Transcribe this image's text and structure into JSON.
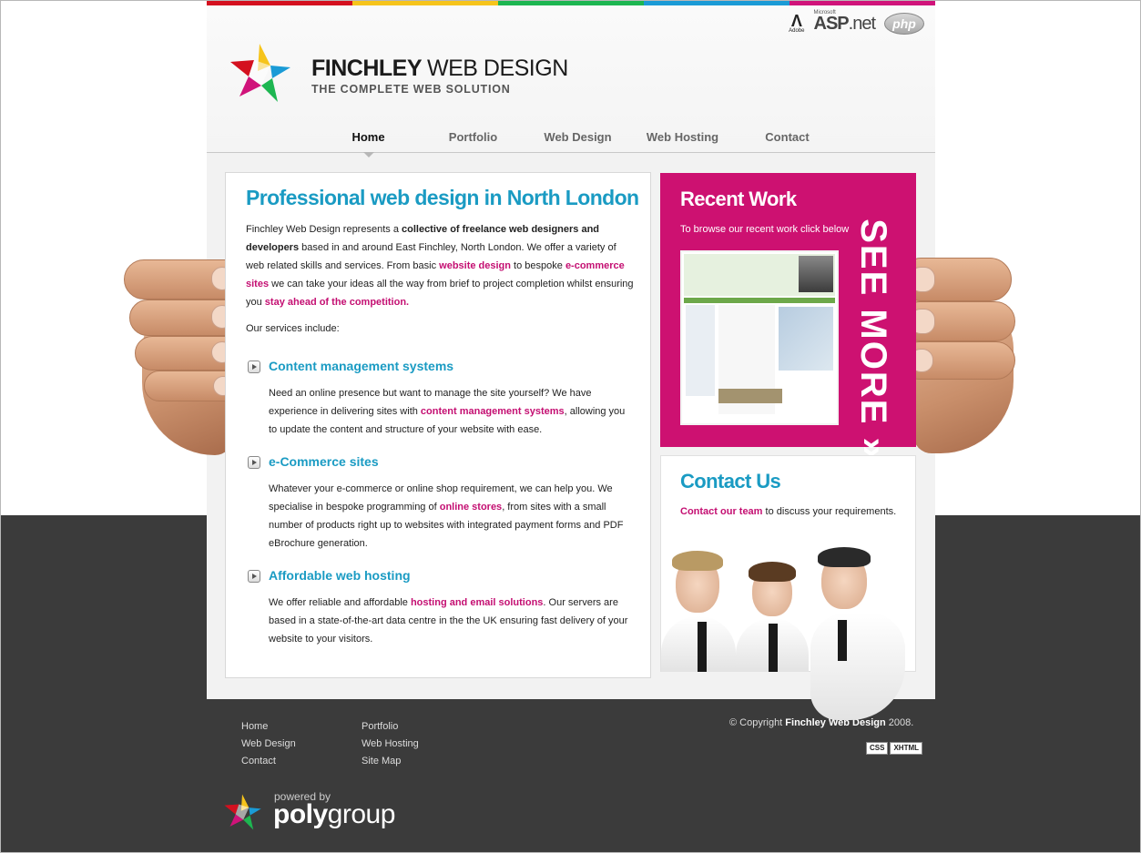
{
  "colors": {
    "accent_blue": "#1a9bc3",
    "accent_pink": "#cd1171",
    "bar": [
      "#d4101f",
      "#f6c41b",
      "#1db651",
      "#1a9bd6",
      "#d0137a"
    ]
  },
  "header": {
    "logo_title_bold": "FINCHLEY",
    "logo_title_rest": "WEB DESIGN",
    "logo_subtitle": "THE COMPLETE WEB SOLUTION",
    "tech_adobe": "Adobe",
    "tech_ms": "Microsoft",
    "tech_asp": "ASP",
    "tech_net": ".net",
    "tech_php": "php"
  },
  "nav": {
    "items": [
      {
        "label": "Home"
      },
      {
        "label": "Portfolio"
      },
      {
        "label": "Web Design"
      },
      {
        "label": "Web Hosting"
      },
      {
        "label": "Contact"
      }
    ]
  },
  "main": {
    "title": "Professional web design in North London",
    "intro": {
      "p1": "Finchley Web Design represents a ",
      "b1": "collective of freelance web designers and developers",
      "p2": " based in and around East Finchley, North London. We offer a variety of web related skills and services. From basic ",
      "l1": "website design",
      "p3": " to bespoke ",
      "l2": "e-commerce sites",
      "p4": " we can take your ideas all the way from brief to project completion whilst ensuring you ",
      "l3": "stay ahead of the competition."
    },
    "services_lead": "Our services include:",
    "services": [
      {
        "title": "Content management systems",
        "pre": "Need an online presence but want to manage the site yourself? We have experience in delivering sites with ",
        "link": "content management systems",
        "post": ", allowing you to update the content and structure of your website with ease."
      },
      {
        "title": "e-Commerce sites",
        "pre": "Whatever your e-commerce or online shop requirement, we can help you. We specialise in bespoke programming of ",
        "link": "online stores",
        "post": ", from sites with a small number of products right up to websites with integrated payment forms and PDF eBrochure generation."
      },
      {
        "title": "Affordable web hosting",
        "pre": "We offer reliable and affordable ",
        "link": "hosting and email solutions",
        "post": ". Our servers are based in a state-of-the-art data centre in the the UK ensuring fast delivery of your website to your visitors."
      }
    ]
  },
  "recent": {
    "title": "Recent Work",
    "lead": "To browse our recent work click below",
    "see_more": "SEE MORE »"
  },
  "contact": {
    "title": "Contact Us",
    "link": "Contact our team",
    "rest": " to discuss your requirements."
  },
  "footer": {
    "col1": [
      "Home",
      "Web Design",
      "Contact"
    ],
    "col2": [
      "Portfolio",
      "Web Hosting",
      "Site Map"
    ],
    "copyright_pre": "© Copyright ",
    "copyright_brand": "Finchley Web Design",
    "copyright_year": " 2008.",
    "badges": [
      "CSS",
      "XHTML"
    ],
    "powered_by": "powered by",
    "brand_bold": "poly",
    "brand_rest": "group"
  }
}
